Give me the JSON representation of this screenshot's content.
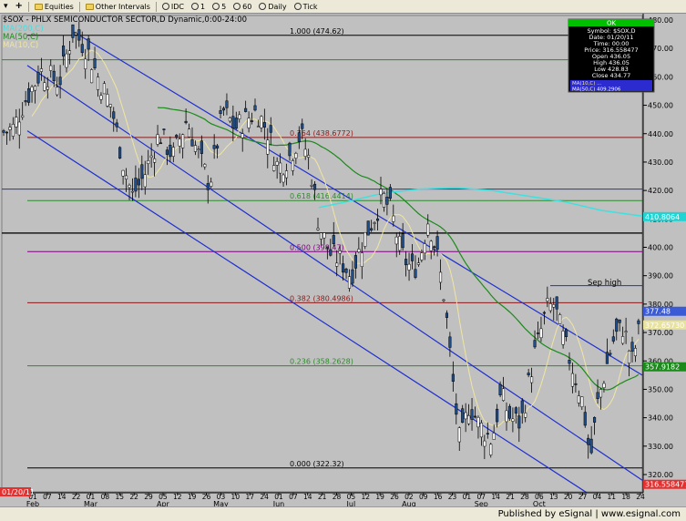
{
  "toolbar": {
    "equities_label": "Equities",
    "other_intervals_label": "Other Intervals",
    "idc_label": "IDC",
    "intervals": [
      "1",
      "5",
      "60",
      "Daily",
      "Tick"
    ]
  },
  "footer": {
    "published": "Published by eSignal | www.esignal.com"
  },
  "chart_data": {
    "type": "candlestick",
    "title": "$SOX - PHLX SEMICONDUCTOR SECTOR,D Dynamic,0:00-24:00",
    "ma_labels": [
      "MA(200,C)",
      "MA(50,C)",
      "MA(10,C)"
    ],
    "ylim": [
      318,
      484
    ],
    "y_ticks": [
      320,
      330,
      340,
      350,
      360,
      370,
      380,
      390,
      400,
      410,
      420,
      430,
      440,
      450,
      460,
      470,
      480
    ],
    "x_day_labels": [
      "01",
      "07",
      "14",
      "22",
      "01",
      "08",
      "15",
      "22",
      "29",
      "05",
      "12",
      "19",
      "26",
      "03",
      "10",
      "17",
      "24",
      "01",
      "07",
      "14",
      "21",
      "28",
      "05",
      "12",
      "19",
      "26",
      "02",
      "09",
      "16",
      "23",
      "01",
      "07",
      "14",
      "21",
      "28",
      "06",
      "13",
      "20",
      "27",
      "04",
      "11",
      "18",
      "24"
    ],
    "x_month_labels": [
      "Feb",
      "Mar",
      "Apr",
      "May",
      "Jun",
      "Jul",
      "Aug",
      "Sep",
      "Oct"
    ],
    "fib_levels": [
      {
        "label": "1.000 (474.62)",
        "value": 474.62,
        "color": "#000000"
      },
      {
        "label": "0.764 (438.6772)",
        "value": 438.6772,
        "color": "#8b1a1a"
      },
      {
        "label": "0.618 (416.4414)",
        "value": 416.4414,
        "color": "#2d8a2d"
      },
      {
        "label": "0.500 (398.47)",
        "value": 398.47,
        "color": "#800080"
      },
      {
        "label": "0.382 (380.4986)",
        "value": 380.4986,
        "color": "#8b1a1a"
      },
      {
        "label": "0.236 (358.2628)",
        "value": 358.2628,
        "color": "#2d8a2d"
      },
      {
        "label": "0.000 (322.32)",
        "value": 322.32,
        "color": "#000000"
      }
    ],
    "annotation": "Sep high",
    "price_tags": [
      {
        "label": "410.8064",
        "value": 410.8,
        "bg": "#22d3d3",
        "fg": "#ffffff"
      },
      {
        "label": "377.48",
        "value": 377.48,
        "bg": "#3b5bd6",
        "fg": "#ffffff"
      },
      {
        "label": "372.65730",
        "value": 372.66,
        "bg": "#e8e2a0",
        "fg": "#ffffff"
      },
      {
        "label": "357.9182",
        "value": 357.92,
        "bg": "#1a8a1a",
        "fg": "#ffffff"
      },
      {
        "label": "316.558477",
        "value": 316.56,
        "bg": "#e53030",
        "fg": "#ffffff"
      }
    ],
    "date_tag": "01/20/11",
    "info_box": {
      "header": "OK",
      "rows": [
        "Symbol: $SOX,D",
        "Date: 01/20/11",
        "Time: 00:00",
        "Price: 316.558477",
        "Open 436.05",
        "High 436.05",
        "Low 428.83",
        "Close 434.77"
      ],
      "ma_rows": [
        "MA(10,C) ...",
        "MA(50,C) 409.2906"
      ]
    },
    "colors": {
      "background": "#c0c0c0",
      "candle": "#1f4e8c",
      "channel": "#1f2fd0",
      "ma10": "#f0e6a0",
      "ma50": "#1a8a1a",
      "ma200": "#3fe0e0"
    }
  }
}
